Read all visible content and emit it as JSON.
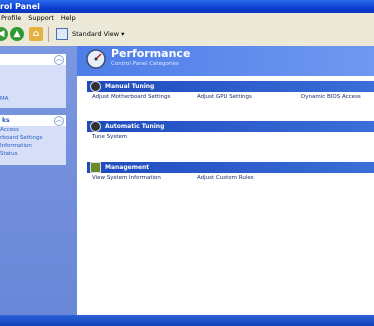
{
  "window": {
    "title": "rol Panel"
  },
  "menu": [
    "Profile",
    "Support",
    "Help"
  ],
  "toolbar": {
    "view_label": "Standard View"
  },
  "sidebar": {
    "panel1": {
      "items": [
        "MA"
      ]
    },
    "panel2": {
      "title": "ks",
      "items": [
        "Access",
        "rboard Settings",
        "Information",
        "Status"
      ]
    }
  },
  "header": {
    "title": "Performance",
    "subtitle": "Control Panel Categories"
  },
  "sections": [
    {
      "title": "Manual Tuning",
      "links": [
        "Adjust Motherboard Settings",
        "Adjust GPU Settings",
        "Dynamic BIOS Access"
      ]
    },
    {
      "title": "Automatic Tuning",
      "links": [
        "Tune System"
      ]
    },
    {
      "title": "Management",
      "links": [
        "View System Information",
        "Adjust Custom Rules"
      ]
    }
  ]
}
